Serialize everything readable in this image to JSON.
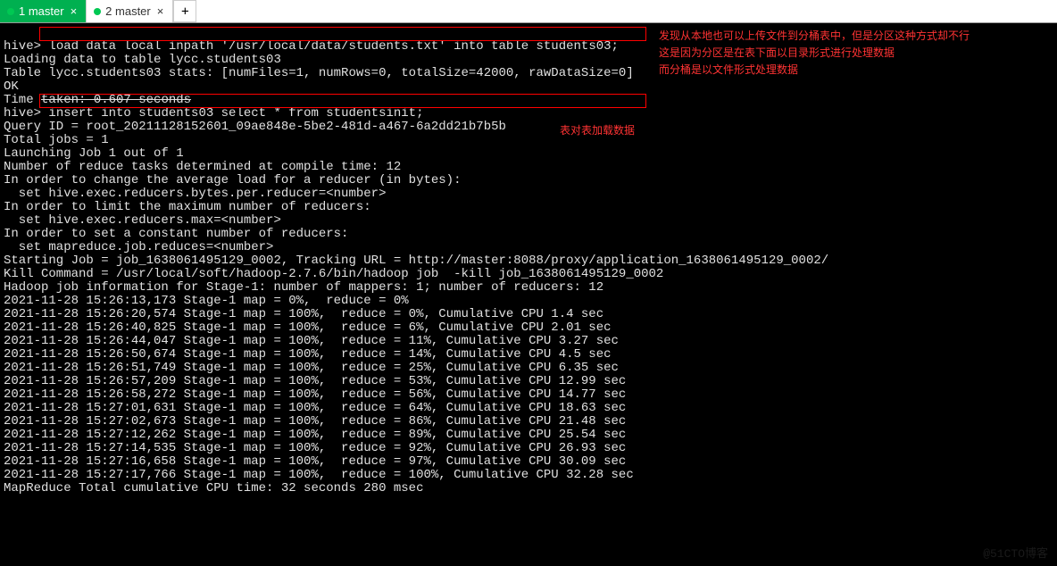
{
  "tabs": {
    "tab1": "1 master",
    "tab2": "2 master",
    "add": "+",
    "close": "×"
  },
  "terminal": {
    "p1": "hive>",
    "cmd1": " load data local inpath '/usr/local/data/students.txt' into table students03;",
    "l2": "Loading data to table lycc.students03",
    "l3": "Table lycc.students03 stats: [numFiles=1, numRows=0, totalSize=42000, rawDataSize=0]",
    "l4": "OK",
    "l5a": "Time ",
    "l5b": "taken: 0.607 seconds",
    "p2": "hive>",
    "cmd2": " insert into students03 select * from studentsinit;",
    "l7": "Query ID = root_20211128152601_09ae848e-5be2-481d-a467-6a2dd21b7b5b",
    "l8": "Total jobs = 1",
    "l9": "Launching Job 1 out of 1",
    "l10": "Number of reduce tasks determined at compile time: 12",
    "l11": "In order to change the average load for a reducer (in bytes):",
    "l12": "  set hive.exec.reducers.bytes.per.reducer=<number>",
    "l13": "In order to limit the maximum number of reducers:",
    "l14": "  set hive.exec.reducers.max=<number>",
    "l15": "In order to set a constant number of reducers:",
    "l16": "  set mapreduce.job.reduces=<number>",
    "l17": "Starting Job = job_1638061495129_0002, Tracking URL = http://master:8088/proxy/application_1638061495129_0002/",
    "l18": "Kill Command = /usr/local/soft/hadoop-2.7.6/bin/hadoop job  -kill job_1638061495129_0002",
    "l19": "Hadoop job information for Stage-1: number of mappers: 1; number of reducers: 12",
    "l20": "2021-11-28 15:26:13,173 Stage-1 map = 0%,  reduce = 0%",
    "l21": "2021-11-28 15:26:20,574 Stage-1 map = 100%,  reduce = 0%, Cumulative CPU 1.4 sec",
    "l22": "2021-11-28 15:26:40,825 Stage-1 map = 100%,  reduce = 6%, Cumulative CPU 2.01 sec",
    "l23": "2021-11-28 15:26:44,047 Stage-1 map = 100%,  reduce = 11%, Cumulative CPU 3.27 sec",
    "l24": "2021-11-28 15:26:50,674 Stage-1 map = 100%,  reduce = 14%, Cumulative CPU 4.5 sec",
    "l25": "2021-11-28 15:26:51,749 Stage-1 map = 100%,  reduce = 25%, Cumulative CPU 6.35 sec",
    "l26": "2021-11-28 15:26:57,209 Stage-1 map = 100%,  reduce = 53%, Cumulative CPU 12.99 sec",
    "l27": "2021-11-28 15:26:58,272 Stage-1 map = 100%,  reduce = 56%, Cumulative CPU 14.77 sec",
    "l28": "2021-11-28 15:27:01,631 Stage-1 map = 100%,  reduce = 64%, Cumulative CPU 18.63 sec",
    "l29": "2021-11-28 15:27:02,673 Stage-1 map = 100%,  reduce = 86%, Cumulative CPU 21.48 sec",
    "l30": "2021-11-28 15:27:12,262 Stage-1 map = 100%,  reduce = 89%, Cumulative CPU 25.54 sec",
    "l31": "2021-11-28 15:27:14,535 Stage-1 map = 100%,  reduce = 92%, Cumulative CPU 26.93 sec",
    "l32": "2021-11-28 15:27:16,658 Stage-1 map = 100%,  reduce = 97%, Cumulative CPU 30.09 sec",
    "l33": "2021-11-28 15:27:17,766 Stage-1 map = 100%,  reduce = 100%, Cumulative CPU 32.28 sec",
    "l34": "MapReduce Total cumulative CPU time: 32 seconds 280 msec"
  },
  "annotations": {
    "a1": "发现从本地也可以上传文件到分桶表中，但是分区这种方式却不行",
    "a2": "这是因为分区是在表下面以目录形式进行处理数据",
    "a3": "而分桶是以文件形式处理数据",
    "a4": "表对表加载数据"
  },
  "watermark": "@51CTO博客"
}
